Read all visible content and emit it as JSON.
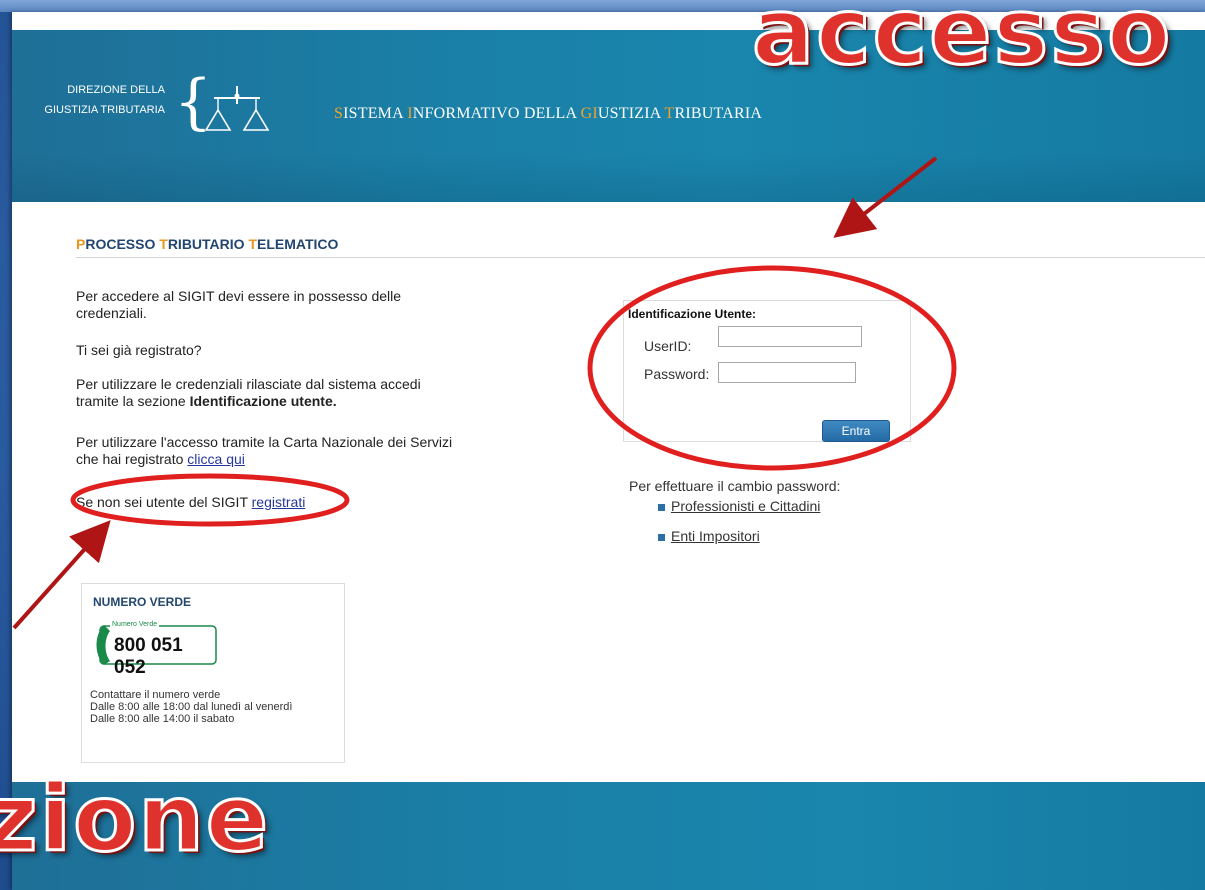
{
  "header": {
    "dir_line1": "DIREZIONE DELLA",
    "dir_line2": "GIUSTIZIA TRIBUTARIA",
    "title_parts": [
      {
        "text": "S",
        "highlight": true
      },
      {
        "text": "ISTEMA ",
        "highlight": false
      },
      {
        "text": "I",
        "highlight": true
      },
      {
        "text": "NFORMATIVO DELLA ",
        "highlight": false
      },
      {
        "text": "GI",
        "highlight": true
      },
      {
        "text": "USTIZIA ",
        "highlight": false
      },
      {
        "text": "T",
        "highlight": true
      },
      {
        "text": "RIBUTARIA",
        "highlight": false
      }
    ]
  },
  "section": {
    "title_p": "P",
    "title_rest1": "ROCESSO ",
    "title_t1": "T",
    "title_rest2": "RIBUTARIO ",
    "title_t2": "T",
    "title_rest3": "ELEMATICO"
  },
  "left": {
    "intro": "Per accedere al SIGIT devi essere in possesso delle credenziali.",
    "question": "Ti sei già registrato?",
    "cred_text": "Per utilizzare le credenziali rilasciate dal sistema accedi tramite la sezione ",
    "cred_bold": "Identificazione utente.",
    "cns_text": "Per utilizzare l'accesso tramite la Carta Nazionale dei Servizi che hai registrato ",
    "cns_link": "clicca qui",
    "reg_text": "Se non sei utente del SIGIT ",
    "reg_link": "registrati"
  },
  "login": {
    "title": "Identificazione Utente:",
    "userid_label": "UserID:",
    "userid_value": "",
    "password_label": "Password:",
    "password_value": "",
    "submit": "Entra"
  },
  "password_change": {
    "label": "Per effettuare il cambio password:",
    "links": [
      "Professionisti e Cittadini",
      "Enti Impositori"
    ]
  },
  "numero_verde": {
    "title": "NUMERO VERDE",
    "badge_caption": "Numero Verde",
    "number": "800 051 052",
    "line1": "Contattare il numero verde",
    "line2": "Dalle 8:00 alle 18:00 dal lunedì al venerdì",
    "line3": "Dalle 8:00 alle 14:00 il sabato"
  },
  "annotations": {
    "word_top": "accesso",
    "word_bottom": "zione",
    "color": "#e0322c"
  }
}
